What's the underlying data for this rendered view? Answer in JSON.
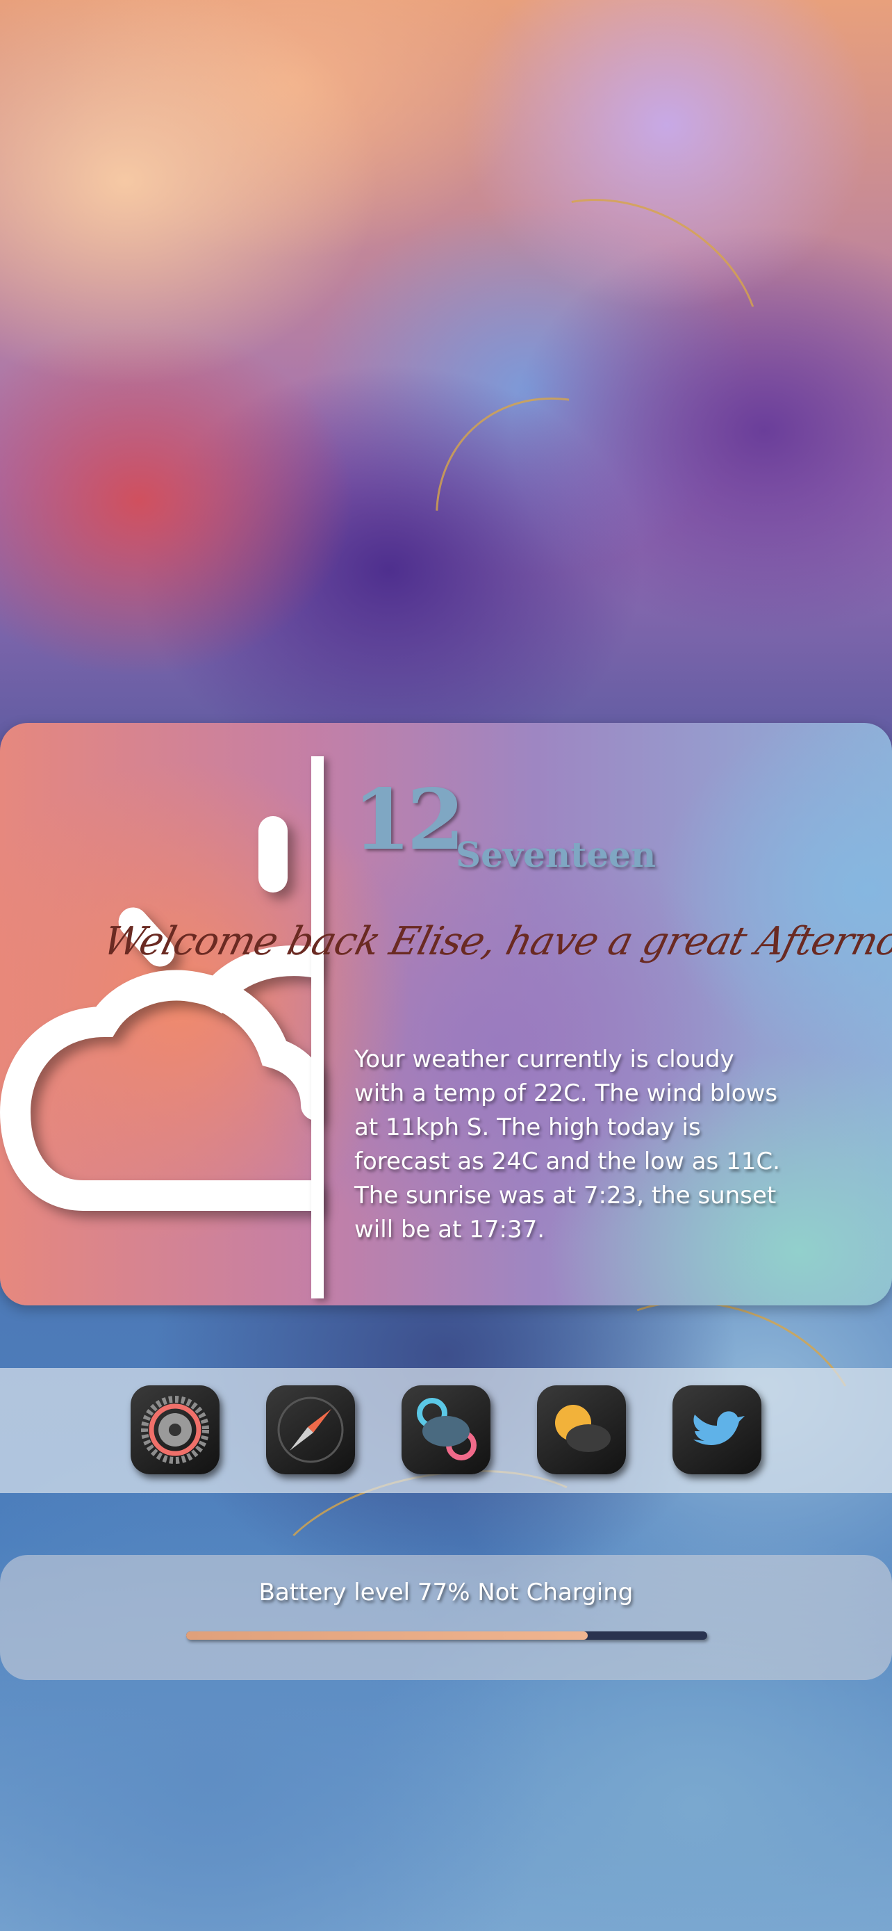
{
  "widget": {
    "time_hour": "12",
    "time_minute_word": "Seventeen",
    "greeting": "Welcome back Elise, have a great Afternoon!",
    "weather_text": "Your weather currently  is cloudy with a temp of 22C. The wind blows at 11kph S. The high today is forecast as 24C and the low as 11C. The sunrise was at 7:23, the sunset will be at 17:37."
  },
  "dock": {
    "apps": [
      {
        "name": "settings-app-icon"
      },
      {
        "name": "compass-app-icon"
      },
      {
        "name": "game-center-app-icon"
      },
      {
        "name": "weather-app-icon"
      },
      {
        "name": "twitter-app-icon"
      }
    ]
  },
  "battery": {
    "label": "Battery level 77% Not Charging",
    "level_fraction": 0.77
  },
  "colors": {
    "time_color": "#7fa7c3",
    "greeting_color": "#6a2a22",
    "battery_fill": "#f0b590",
    "battery_track": "#2a3350"
  }
}
